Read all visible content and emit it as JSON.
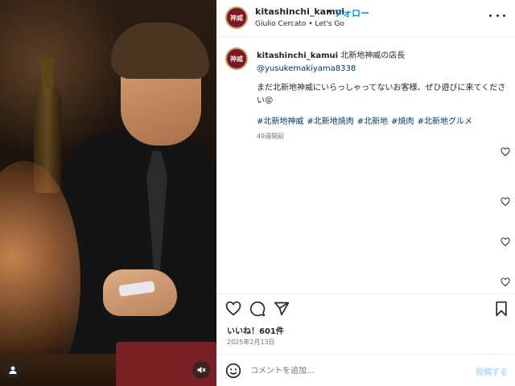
{
  "post": {
    "username": "kitashinchi_kamui",
    "separator": "•",
    "follow_label": "フォロー",
    "subline": "Giulio Cercato • Let's Go",
    "avatar_text": "神威"
  },
  "caption": {
    "username": "kitashinchi_kamui",
    "lead": " 北新地神威の店長 ",
    "mention": "@yusukemakiyama8338",
    "text": "まだ北新地神威にいらっしゃってないお客様、ぜひ遊びに来てください😝",
    "hashtags": [
      "#北新地神威",
      "#北新地焼肉",
      "#北新地",
      "#焼肉",
      "#北新地グルメ"
    ],
    "ago": "49週間前"
  },
  "engagement": {
    "likes": "いいね！601件",
    "date": "2025年2月13日"
  },
  "comment_box": {
    "placeholder": "コメントを追加...",
    "post_label": "投稿する"
  },
  "icons": {
    "like": "heart-icon",
    "comment": "comment-icon",
    "share": "send-icon",
    "save": "bookmark-icon",
    "emoji": "emoji-icon",
    "more": "more-icon",
    "tagged_user": "user-icon",
    "audio": "mute-icon"
  },
  "colors": {
    "link": "#0095f6",
    "hashtag": "#00376b",
    "muted": "#737373",
    "post_disabled": "#b2dffc"
  }
}
